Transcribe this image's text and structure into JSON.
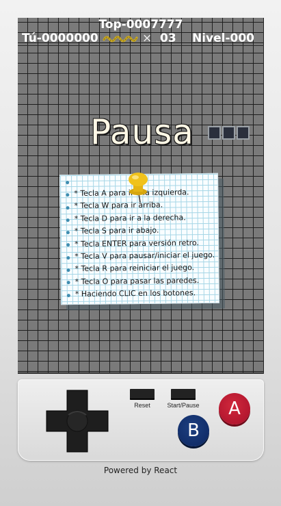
{
  "hud": {
    "top_score": "Top-0007777",
    "player_score": "Tú-0000000",
    "times_sign": "×",
    "lives": "03",
    "level": "Nivel-000"
  },
  "pause": {
    "title": "Pausa",
    "instructions": [
      "* Tecla A para ir a la izquierda.",
      "* Tecla W para ir arriba.",
      "* Tecla D para ir a la derecha.",
      "* Tecla S para ir abajo.",
      "* Tecla ENTER para versión retro.",
      "* Tecla V para pausar/iniciar el juego.",
      "* Tecla R para reiniciar el juego.",
      "* Tecla O para pasar las paredes.",
      "* Haciendo CLIC en los botones."
    ]
  },
  "controls": {
    "reset_label": "Reset",
    "start_pause_label": "Start/Pause",
    "a_label": "A",
    "b_label": "B"
  },
  "footer": "Powered by React",
  "colors": {
    "board": "#7a7a7a",
    "grid": "#1e1e1e",
    "button_a": "#c01f35",
    "button_b": "#12306c",
    "snake_icon": "#c9a81f"
  },
  "icons": [
    "snake-icon",
    "pushpin-icon",
    "dpad-icon"
  ]
}
